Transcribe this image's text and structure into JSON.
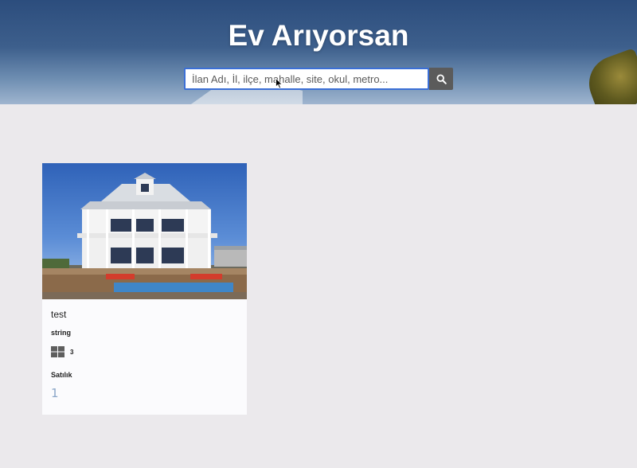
{
  "hero": {
    "title": "Ev Arıyorsan",
    "search_placeholder": "İlan Adı, İl, ilçe, mahalle, site, okul, metro...",
    "search_icon": "search-icon"
  },
  "listing": {
    "title": "test",
    "subtitle": "string",
    "rooms_icon": "grid-icon",
    "rooms": "3",
    "status": "Satılık",
    "price": "1"
  }
}
